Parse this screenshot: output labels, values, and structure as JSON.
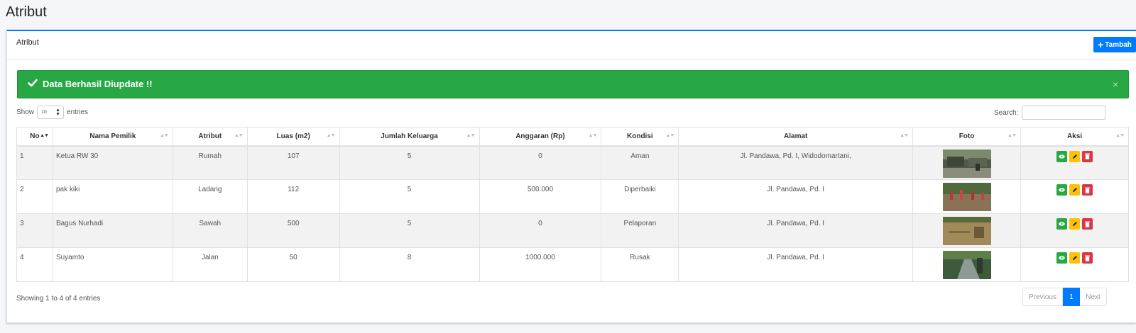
{
  "page": {
    "title": "Atribut"
  },
  "card": {
    "title": "Atribut",
    "add_button": "Tambah"
  },
  "alert": {
    "message": "Data Berhasil Diupdate !!",
    "close": "×"
  },
  "controls": {
    "show_label": "Show",
    "entries_label": "entries",
    "page_length": "10",
    "search_label": "Search:"
  },
  "table": {
    "columns": [
      "No",
      "Nama Pemilik",
      "Atribut",
      "Luas (m2)",
      "Jumlah Keluarga",
      "Anggaran (Rp)",
      "Kondisi",
      "Alamat",
      "Foto",
      "Aksi"
    ],
    "rows": [
      {
        "no": "1",
        "nama": "Ketua RW 30",
        "atribut": "Rumah",
        "luas": "107",
        "jumlah": "5",
        "anggaran": "0",
        "kondisi": "Aman",
        "alamat": "Jl. Pandawa, Pd. I, Widodomartani,"
      },
      {
        "no": "2",
        "nama": "pak kiki",
        "atribut": "Ladang",
        "luas": "112",
        "jumlah": "5",
        "anggaran": "500.000",
        "kondisi": "Diperbaiki",
        "alamat": "Jl. Pandawa, Pd. I"
      },
      {
        "no": "3",
        "nama": "Bagus Nurhadi",
        "atribut": "Sawah",
        "luas": "500",
        "jumlah": "5",
        "anggaran": "0",
        "kondisi": "Pelaporan",
        "alamat": "Jl. Pandawa, Pd. I"
      },
      {
        "no": "4",
        "nama": "Suyamto",
        "atribut": "Jalan",
        "luas": "50",
        "jumlah": "8",
        "anggaran": "1000.000",
        "kondisi": "Rusak",
        "alamat": "Jl. Pandawa, Pd. I"
      }
    ]
  },
  "footer": {
    "info": "Showing 1 to 4 of 4 entries",
    "previous": "Previous",
    "current_page": "1",
    "next": "Next"
  },
  "colors": {
    "primary": "#007bff",
    "success": "#28a745",
    "warning": "#ffc107",
    "danger": "#dc3545"
  },
  "icons": [
    "check-icon",
    "plus-icon",
    "close-icon",
    "sort-icon",
    "eye-icon",
    "pencil-icon",
    "trash-icon",
    "photo-icon"
  ]
}
